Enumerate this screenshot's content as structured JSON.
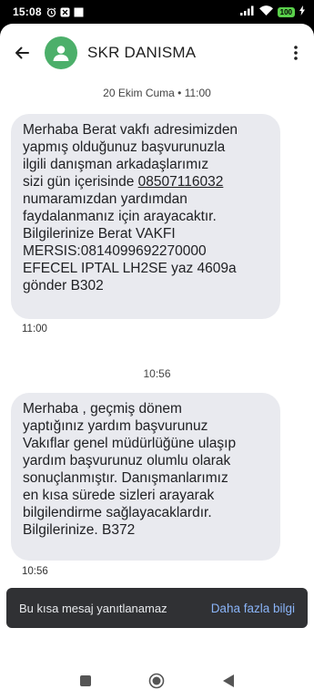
{
  "status_bar": {
    "time": "15:08",
    "battery": "100",
    "icons_left": [
      "alarm-icon",
      "notification-icon",
      "square-icon"
    ],
    "icons_right": [
      "signal-icon",
      "wifi-icon",
      "battery-icon",
      "charging-icon"
    ]
  },
  "header": {
    "contact_name": "SKR DANISMA",
    "back_icon": "back-arrow-icon",
    "menu_icon": "more-vert-icon",
    "avatar_color": "#4caf6a"
  },
  "conversation": {
    "date_separator": "20 Ekim Cuma • 11:00",
    "messages": [
      {
        "lines": [
          "Merhaba Berat vakfı adresimizden",
          "yapmış olduğunuz başvurunuzla",
          "ilgili danışman arkadaşlarımız",
          "sizi gün içerisinde",
          "numaramızdan yardımdan",
          "faydalanmanız için arayacaktır.",
          "Bilgilerinize Berat VAKFI",
          "MERSIS:0814099692270000",
          "EFECEL IPTAL LH2SE yaz 4609a",
          "gönder  B302"
        ],
        "phone": "08507116032",
        "time": "11:00"
      },
      {
        "separator": "10:56",
        "lines": [
          "Merhaba , geçmiş dönem",
          "yaptığınız yardım başvurunuz",
          "Vakıflar genel müdürlüğüne ulaşıp",
          "yardım başvurunuz olumlu olarak",
          "sonuçlanmıştır. Danışmanlarımız",
          "en kısa sürede sizleri arayarak",
          "bilgilendirme sağlayacaklardır.",
          "Bilgilerinize. B372"
        ],
        "time": "10:56"
      }
    ]
  },
  "snackbar": {
    "text": "Bu kısa mesaj yanıtlanamaz",
    "action": "Daha fazla bilgi"
  },
  "nav": {
    "icons": [
      "recents-square-icon",
      "home-circle-icon",
      "back-triangle-icon"
    ]
  },
  "colors": {
    "bubble": "#e9eaef",
    "snackbar": "#303134",
    "snackbar_action": "#8ab4f8",
    "battery": "#5ad14b"
  }
}
